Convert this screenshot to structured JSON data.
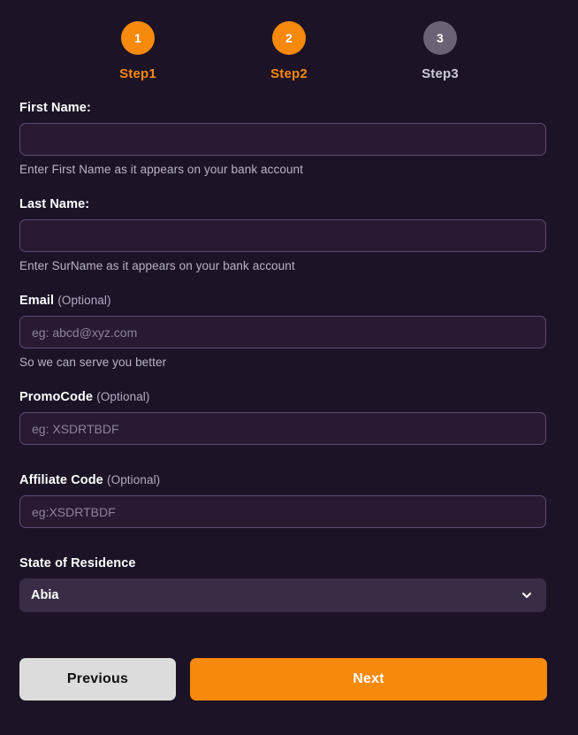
{
  "stepper": {
    "steps": [
      {
        "number": "1",
        "label": "Step1",
        "state": "active"
      },
      {
        "number": "2",
        "label": "Step2",
        "state": "active"
      },
      {
        "number": "3",
        "label": "Step3",
        "state": "inactive"
      }
    ]
  },
  "form": {
    "first_name": {
      "label": "First Name:",
      "value": "",
      "placeholder": "",
      "help": "Enter First Name as it appears on your bank account"
    },
    "last_name": {
      "label": "Last Name:",
      "value": "",
      "placeholder": "",
      "help": "Enter SurName as it appears on your bank account"
    },
    "email": {
      "label": "Email",
      "optional": "(Optional)",
      "value": "",
      "placeholder": "eg: abcd@xyz.com",
      "help": "So we can serve you better"
    },
    "promo_code": {
      "label": "PromoCode",
      "optional": "(Optional)",
      "value": "",
      "placeholder": "eg: XSDRTBDF"
    },
    "affiliate_code": {
      "label": "Affiliate Code",
      "optional": "(Optional)",
      "value": "",
      "placeholder": "eg:XSDRTBDF"
    },
    "state_of_residence": {
      "label": "State of Residence",
      "selected": "Abia",
      "icon": "chevron-down-icon"
    }
  },
  "buttons": {
    "previous": "Previous",
    "next": "Next"
  },
  "colors": {
    "background": "#1d1326",
    "accent_orange": "#f7890c",
    "input_background": "#281b31",
    "input_border": "#5b4a6e",
    "select_background": "#392c45",
    "inactive_step": "#6c6275",
    "previous_button": "#dcdcdc",
    "help_text": "#b9b3c7"
  }
}
